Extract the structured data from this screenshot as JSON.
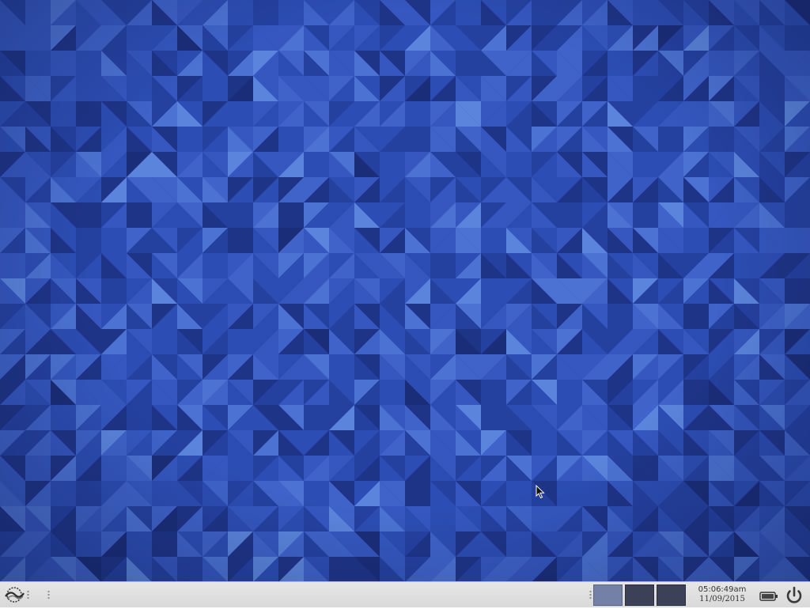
{
  "desktop": {
    "wallpaper_colors": [
      "#1e3487",
      "#2541a0",
      "#2c4db3",
      "#3557bf",
      "#3f63c9",
      "#4c73d3",
      "#5b85dc",
      "#1a2d78"
    ]
  },
  "taskbar": {
    "menu_icon": "app-menu-icon",
    "workspaces": [
      {
        "label": "",
        "active": true
      },
      {
        "label": "",
        "active": false
      },
      {
        "label": "",
        "active": false
      }
    ],
    "clock": {
      "time": "05:06:49am",
      "date": "11/09/2015"
    },
    "battery_icon": "battery-icon",
    "power_icon": "power-icon"
  }
}
